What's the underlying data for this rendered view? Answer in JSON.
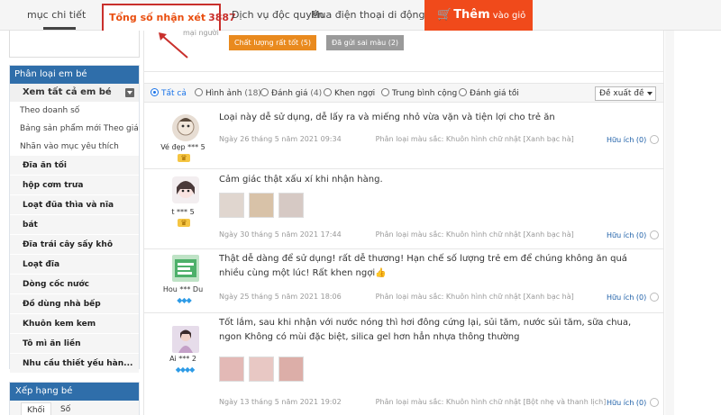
{
  "tabs": {
    "detail": "mục chi tiết",
    "reviews_label": "Tổng số nhận xét",
    "reviews_count": "3887",
    "service": "Dịch vụ độc quyền",
    "mobile": "Mua điện thoại di động"
  },
  "cart_button": {
    "main": "Thêm",
    "sub": "vào giỏ"
  },
  "summary": {
    "user_hint": "mại người",
    "tags": [
      "Chất lượng rất tốt (5)",
      "Đã gửi sai màu (2)"
    ]
  },
  "filters": {
    "options": [
      {
        "label": "Tất cả",
        "count": "",
        "selected": true
      },
      {
        "label": "Hình ảnh",
        "count": "(18)",
        "selected": false
      },
      {
        "label": "Đánh giá",
        "count": "(4)",
        "selected": false
      },
      {
        "label": "Khen ngợi",
        "count": "",
        "selected": false
      },
      {
        "label": "Trung bình cộng",
        "count": "",
        "selected": false
      },
      {
        "label": "Đánh giá tồi",
        "count": "",
        "selected": false
      }
    ],
    "sort_value": "Đề xuất đề"
  },
  "sidebar": {
    "category_title": "Phân loại em bé",
    "view_all": "Xem tất cả em bé",
    "subs": [
      "Theo doanh số",
      "Bảng sản phẩm mới Theo giá cả",
      "Nhãn vào mục yêu thích"
    ],
    "items": [
      "Đĩa ăn tối",
      "hộp cơm trưa",
      "Loạt đũa thìa và nĩa",
      "bát",
      "Đĩa trái cây sấy khô",
      "Loạt đĩa",
      "Dòng cốc nước",
      "Đồ dùng nhà bếp",
      "Khuôn kem kem",
      "Tô mì ăn liền",
      "Nhu cầu thiết yếu hàn..."
    ],
    "ranking_title": "Xếp hạng bé",
    "ranking_tabs": [
      "Khối",
      "Số"
    ]
  },
  "reviews": [
    {
      "user": "Vé đẹp *** 5",
      "badge": "crown",
      "text": "Loại này dễ sử dụng, dễ lấy ra và miếng nhỏ vừa vặn và tiện lợi cho trẻ ăn",
      "date": "Ngày 26 tháng 5 năm 2021 09:34",
      "variant": "Phân loại màu sắc: Khuôn hình chữ nhật [Xanh bạc hà]",
      "helpful": "Hữu ích (0)"
    },
    {
      "user": "t *** 5",
      "badge": "crown",
      "text": "Cảm giác thật xấu xí khi nhận hàng.",
      "date": "Ngày 30 tháng 5 năm 2021 17:44",
      "variant": "Phân loại màu sắc: Khuôn hình chữ nhật [Xanh bạc hà]",
      "helpful": "Hữu ích (0)"
    },
    {
      "user": "Hou *** Du",
      "badge": "gems",
      "text": "Thật dễ dàng để sử dụng! rất dễ thương! Hạn chế số lượng trẻ em để chúng không ăn quá nhiều cùng một lúc! Rất khen ngợi👍",
      "date": "Ngày 25 tháng 5 năm 2021 18:06",
      "variant": "Phân loại màu sắc: Khuôn hình chữ nhật [Xanh bạc hà]",
      "helpful": "Hữu ích (0)"
    },
    {
      "user": "Ai *** 2",
      "badge": "gems",
      "text": "Tốt lắm, sau khi nhận với nước nóng thì hơi đông cứng lại, sủi tăm, nước sủi tăm, sữa chua, ngon Không có mùi đặc biệt, silica gel hơn hẳn nhựa thông thường",
      "date": "Ngày 13 tháng 5 năm 2021 19:02",
      "variant": "Phân loại màu sắc: Khuôn hình chữ nhật [Bột nhẹ và thanh lịch]",
      "helpful": "Hữu ích (0)"
    }
  ],
  "icons": {
    "cart": "cart-icon",
    "collapse": "collapse-icon",
    "crown": "crown-icon",
    "gem": "gem-icon",
    "thumb": "thumb-up-icon"
  },
  "colors": {
    "accent_orange": "#f04a1b",
    "highlight_red": "#c9302c",
    "sidebar_blue": "#2f6eaa",
    "link_blue": "#1d5fa8"
  }
}
